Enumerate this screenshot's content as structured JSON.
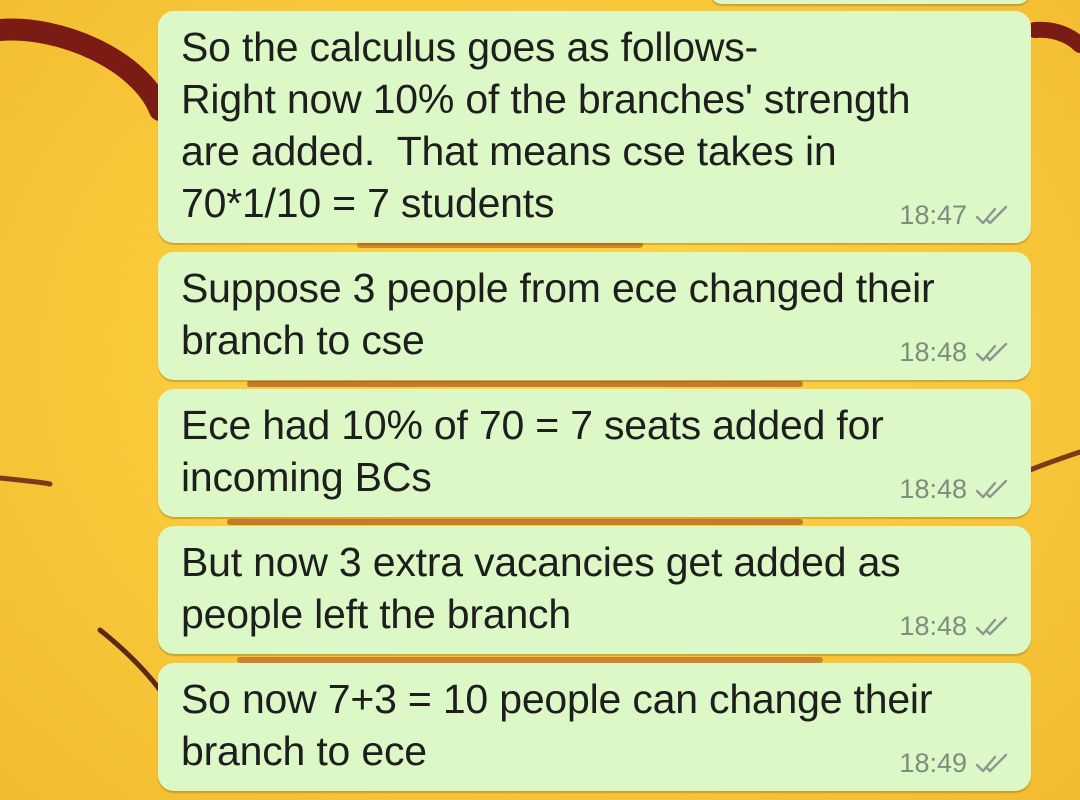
{
  "messages": [
    {
      "text": "So the calculus goes as follows-\nRight now 10% of the branches' strength\nare added.  That means cse takes in\n70*1/10 = 7 students",
      "time": "18:47",
      "status_icon": "double-check-icon"
    },
    {
      "text": "Suppose 3 people from ece changed their\nbranch to cse",
      "time": "18:48",
      "status_icon": "double-check-icon"
    },
    {
      "text": "Ece had 10% of 70 = 7 seats added for\nincoming BCs",
      "time": "18:48",
      "status_icon": "double-check-icon"
    },
    {
      "text": "But now 3 extra vacancies get added as\npeople left the branch",
      "time": "18:48",
      "status_icon": "double-check-icon"
    },
    {
      "text": "So now 7+3 = 10 people can change their\nbranch to ece",
      "time": "18:49",
      "status_icon": "double-check-icon"
    }
  ],
  "colors": {
    "bubble_outgoing": "#dcf8c6",
    "wallpaper": "#f9c93a",
    "timestamp": "#808b80",
    "text": "#1e1e1e"
  }
}
